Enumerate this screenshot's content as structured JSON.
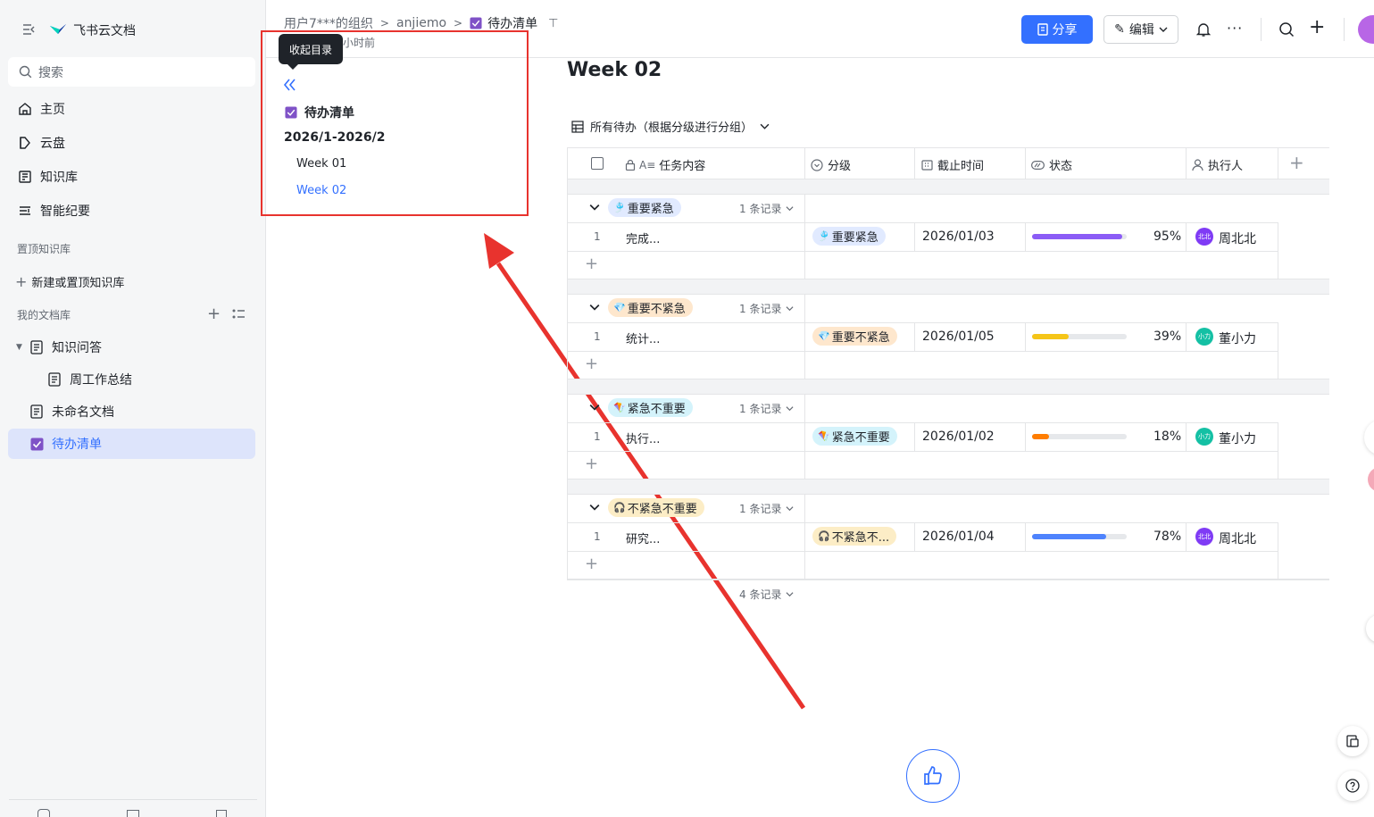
{
  "sidebar": {
    "app_name": "飞书云文档",
    "search_placeholder": "搜索",
    "nav": [
      {
        "label": "主页",
        "icon": "home-icon"
      },
      {
        "label": "云盘",
        "icon": "cloud-drive-icon"
      },
      {
        "label": "知识库",
        "icon": "wiki-icon"
      },
      {
        "label": "智能纪要",
        "icon": "minutes-icon"
      }
    ],
    "pinned_section": "置顶知识库",
    "new_pinned": "新建或置顶知识库",
    "my_library_section": "我的文档库",
    "tree": [
      {
        "label": "知识问答",
        "level": 0,
        "expanded": true
      },
      {
        "label": "周工作总结",
        "level": 1
      },
      {
        "label": "未命名文档",
        "level": 0
      },
      {
        "label": "待办清单",
        "level": 0,
        "active": true
      }
    ]
  },
  "topbar": {
    "breadcrumb": [
      "用户7***的组织",
      "anjiemo",
      "待办清单"
    ],
    "updated": "小时前",
    "share_label": "分享",
    "edit_label": "编辑"
  },
  "toc": {
    "tooltip": "收起目录",
    "doc_title": "待办清单",
    "heading": "2026/1-2026/2",
    "items": [
      "Week 01",
      "Week 02"
    ],
    "active_index": 1
  },
  "doc": {
    "title": "Week 02",
    "view_name": "所有待办（根据分级进行分组）"
  },
  "table": {
    "columns": [
      "任务内容",
      "分级",
      "截止时间",
      "状态",
      "执行人"
    ],
    "groups": [
      {
        "tag": "重要紧急",
        "emoji": "🎐",
        "tag_bg": "#e1eaff",
        "count": "1 条记录",
        "row": {
          "index": "1",
          "task": "完成...",
          "level": "重要紧急",
          "due": "2026/01/03",
          "progress": 95,
          "progress_label": "95%",
          "bar_color": "#8b5cf6",
          "owner": "周北北",
          "owner_avatar": "北北",
          "avatar_color": "#7f3bf5"
        }
      },
      {
        "tag": "重要不紧急",
        "emoji": "💎",
        "tag_bg": "#fee7cd",
        "count": "1 条记录",
        "row": {
          "index": "1",
          "task": "统计...",
          "level": "重要不紧急",
          "due": "2026/01/05",
          "progress": 39,
          "progress_label": "39%",
          "bar_color": "#f5c518",
          "owner": "董小力",
          "owner_avatar": "小力",
          "avatar_color": "#14c0a4"
        }
      },
      {
        "tag": "紧急不重要",
        "emoji": "🪁",
        "tag_bg": "#d4f3fb",
        "count": "1 条记录",
        "row": {
          "index": "1",
          "task": "执行...",
          "level": "紧急不重要",
          "due": "2026/01/02",
          "progress": 18,
          "progress_label": "18%",
          "bar_color": "#ff7d00",
          "owner": "董小力",
          "owner_avatar": "小力",
          "avatar_color": "#14c0a4"
        }
      },
      {
        "tag": "不紧急不重要",
        "emoji": "🎧",
        "tag_bg": "#fcedc6",
        "count": "1 条记录",
        "row": {
          "index": "1",
          "task": "研究...",
          "level": "不紧急不...",
          "due": "2026/01/04",
          "progress": 78,
          "progress_label": "78%",
          "bar_color": "#4e83fd",
          "owner": "周北北",
          "owner_avatar": "北北",
          "avatar_color": "#7f3bf5"
        }
      }
    ],
    "total": "4 条记录"
  },
  "colors": {
    "accent": "#3370ff",
    "annotation": "#e8332e"
  }
}
